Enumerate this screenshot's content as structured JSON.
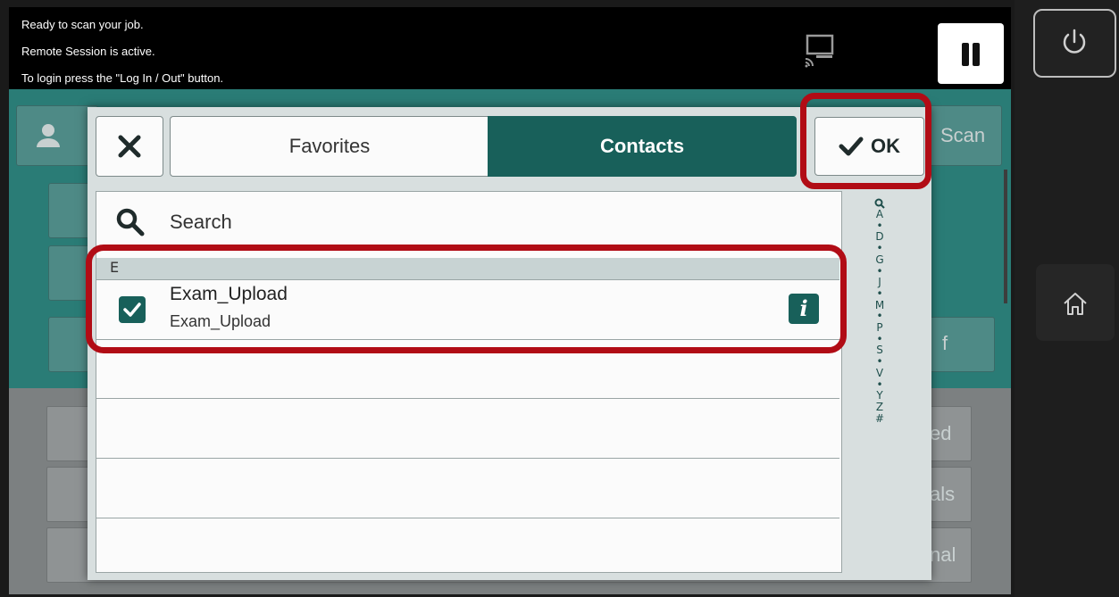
{
  "status": {
    "lines": [
      "Ready to scan your job.",
      "Remote Session is active.",
      "To login press the \"Log In / Out\" button."
    ]
  },
  "background": {
    "scan_label": "Scan",
    "tile_fragments": [
      "f",
      "ed",
      "als",
      "nal"
    ]
  },
  "dialog": {
    "tabs": [
      {
        "label": "Favorites",
        "selected": false
      },
      {
        "label": "Contacts",
        "selected": true
      }
    ],
    "ok_label": "OK",
    "search_label": "Search",
    "group_header": "E",
    "contact": {
      "name": "Exam_Upload",
      "subtitle": "Exam_Upload",
      "checked": true
    },
    "index": [
      "A",
      "•",
      "D",
      "•",
      "G",
      "•",
      "J",
      "•",
      "M",
      "•",
      "P",
      "•",
      "S",
      "•",
      "V",
      "•",
      "Y",
      "Z",
      "#"
    ]
  },
  "colors": {
    "accent": "#18605a",
    "highlight": "#b10c15"
  }
}
